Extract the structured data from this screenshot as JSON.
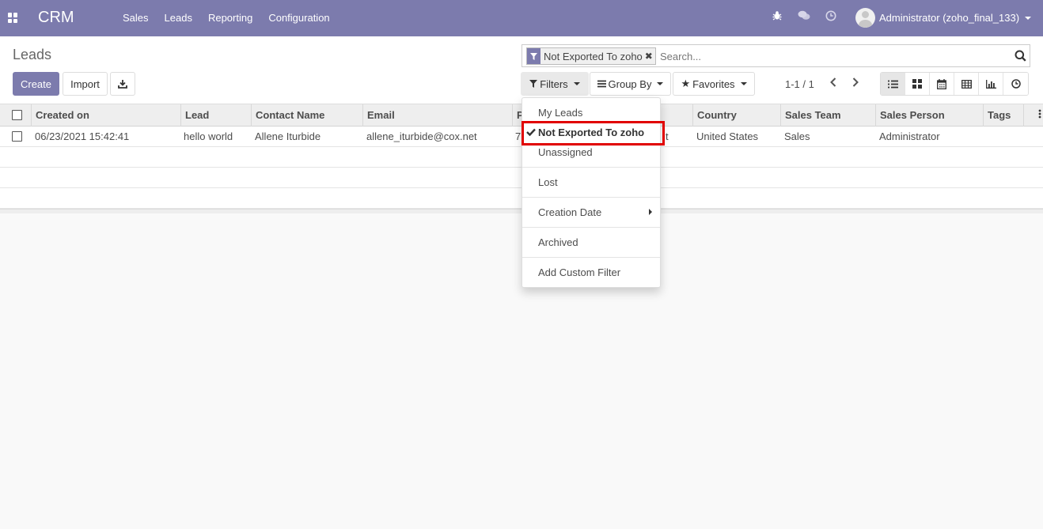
{
  "navbar": {
    "brand": "CRM",
    "menu": [
      "Sales",
      "Leads",
      "Reporting",
      "Configuration"
    ],
    "user": "Administrator (zoho_final_133)"
  },
  "panel": {
    "title": "Leads",
    "create_label": "Create",
    "import_label": "Import",
    "search": {
      "facet_label": "Not Exported To zoho",
      "placeholder": "Search..."
    },
    "filters_label": "Filters",
    "group_by_label": "Group By",
    "favorites_label": "Favorites",
    "pager": "1-1 / 1"
  },
  "table": {
    "columns": [
      "Created on",
      "Lead",
      "Contact Name",
      "Email",
      "P",
      "Country",
      "Sales Team",
      "Sales Person",
      "Tags"
    ],
    "rows": [
      {
        "created_on": "06/23/2021 15:42:41",
        "lead": "hello world",
        "contact_name": "Allene Iturbide",
        "email": "allene_iturbide@cox.net",
        "phone_partial": "7",
        "hidden_partial": "t",
        "country": "United States",
        "sales_team": "Sales",
        "sales_person": "Administrator",
        "tags": ""
      }
    ]
  },
  "filters_menu": {
    "items": [
      "My Leads",
      "Not Exported To zoho",
      "Unassigned",
      "Lost",
      "Creation Date",
      "Archived",
      "Add Custom Filter"
    ],
    "checked": "Not Exported To zoho",
    "highlight_color": "#e10000"
  },
  "colors": {
    "brand": "#7c7bad"
  }
}
